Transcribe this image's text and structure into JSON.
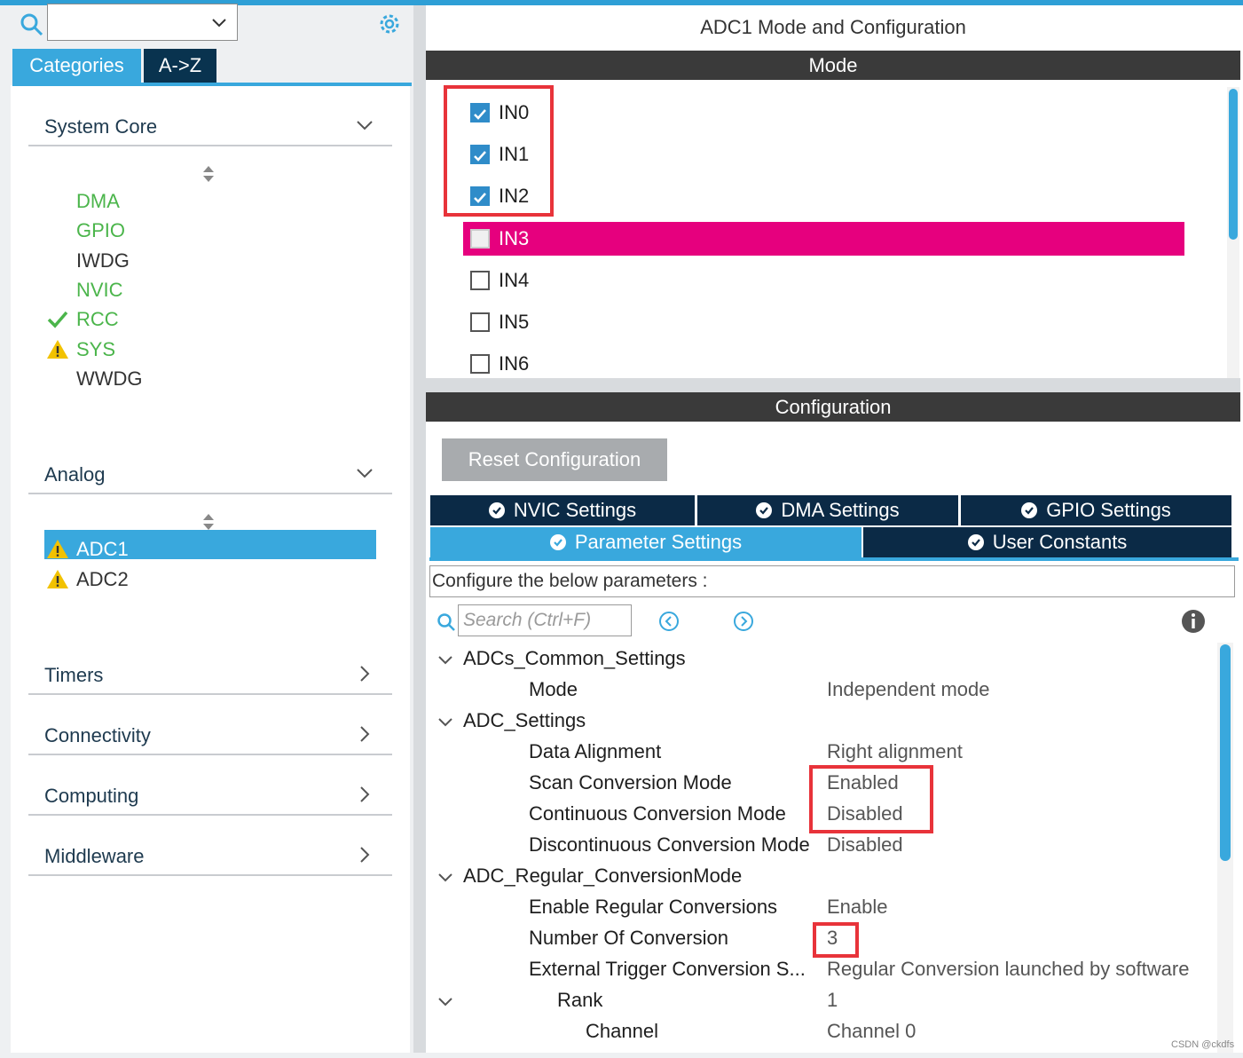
{
  "sidebar": {
    "search_value": "",
    "tabs": [
      "Categories",
      "A->Z"
    ],
    "categories": [
      {
        "label": "System Core",
        "items": [
          {
            "label": "DMA",
            "status": "ok"
          },
          {
            "label": "GPIO",
            "status": "ok"
          },
          {
            "label": "IWDG",
            "status": "none"
          },
          {
            "label": "NVIC",
            "status": "ok"
          },
          {
            "label": "RCC",
            "status": "check"
          },
          {
            "label": "SYS",
            "status": "warning"
          },
          {
            "label": "WWDG",
            "status": "none"
          }
        ]
      },
      {
        "label": "Analog",
        "items": [
          {
            "label": "ADC1",
            "status": "warning",
            "selected": true
          },
          {
            "label": "ADC2",
            "status": "warning"
          }
        ]
      },
      {
        "label": "Timers"
      },
      {
        "label": "Connectivity"
      },
      {
        "label": "Computing"
      },
      {
        "label": "Middleware"
      }
    ]
  },
  "main": {
    "title": "ADC1 Mode and Configuration",
    "mode_header": "Mode",
    "channels": [
      {
        "label": "IN0",
        "checked": true
      },
      {
        "label": "IN1",
        "checked": true
      },
      {
        "label": "IN2",
        "checked": true
      },
      {
        "label": "IN3",
        "checked": false,
        "highlighted": true
      },
      {
        "label": "IN4",
        "checked": false
      },
      {
        "label": "IN5",
        "checked": false
      },
      {
        "label": "IN6",
        "checked": false
      }
    ],
    "config_header": "Configuration",
    "reset_label": "Reset Configuration",
    "tabs": [
      "NVIC Settings",
      "DMA Settings",
      "GPIO Settings",
      "Parameter Settings",
      "User Constants"
    ],
    "active_tab": "Parameter Settings",
    "param_hint": "Configure the below parameters :",
    "search_placeholder": "Search (Ctrl+F)",
    "tree": [
      {
        "type": "group",
        "label": "ADCs_Common_Settings"
      },
      {
        "type": "param",
        "label": "Mode",
        "value": "Independent mode"
      },
      {
        "type": "group",
        "label": "ADC_Settings"
      },
      {
        "type": "param",
        "label": "Data Alignment",
        "value": "Right alignment"
      },
      {
        "type": "param",
        "label": "Scan Conversion Mode",
        "value": "Enabled"
      },
      {
        "type": "param",
        "label": "Continuous Conversion Mode",
        "value": "Disabled"
      },
      {
        "type": "param",
        "label": "Discontinuous Conversion Mode",
        "value": "Disabled"
      },
      {
        "type": "group",
        "label": "ADC_Regular_ConversionMode"
      },
      {
        "type": "param",
        "label": "Enable Regular Conversions",
        "value": "Enable"
      },
      {
        "type": "param",
        "label": "Number Of Conversion",
        "value": "3"
      },
      {
        "type": "param",
        "label": "External Trigger Conversion S...",
        "value": "Regular Conversion launched by software"
      },
      {
        "type": "subgroup",
        "label": "Rank",
        "value": "1"
      },
      {
        "type": "subparam",
        "label": "Channel",
        "value": "Channel 0"
      }
    ]
  },
  "watermark": "CSDN @ckdfs",
  "colors": {
    "accent": "#39a8dd",
    "dark_tab": "#0b2a46",
    "highlight": "#e6007e",
    "ok_green": "#4bb54b",
    "annotation_red": "#e8333a",
    "warning": "#f2c200"
  }
}
